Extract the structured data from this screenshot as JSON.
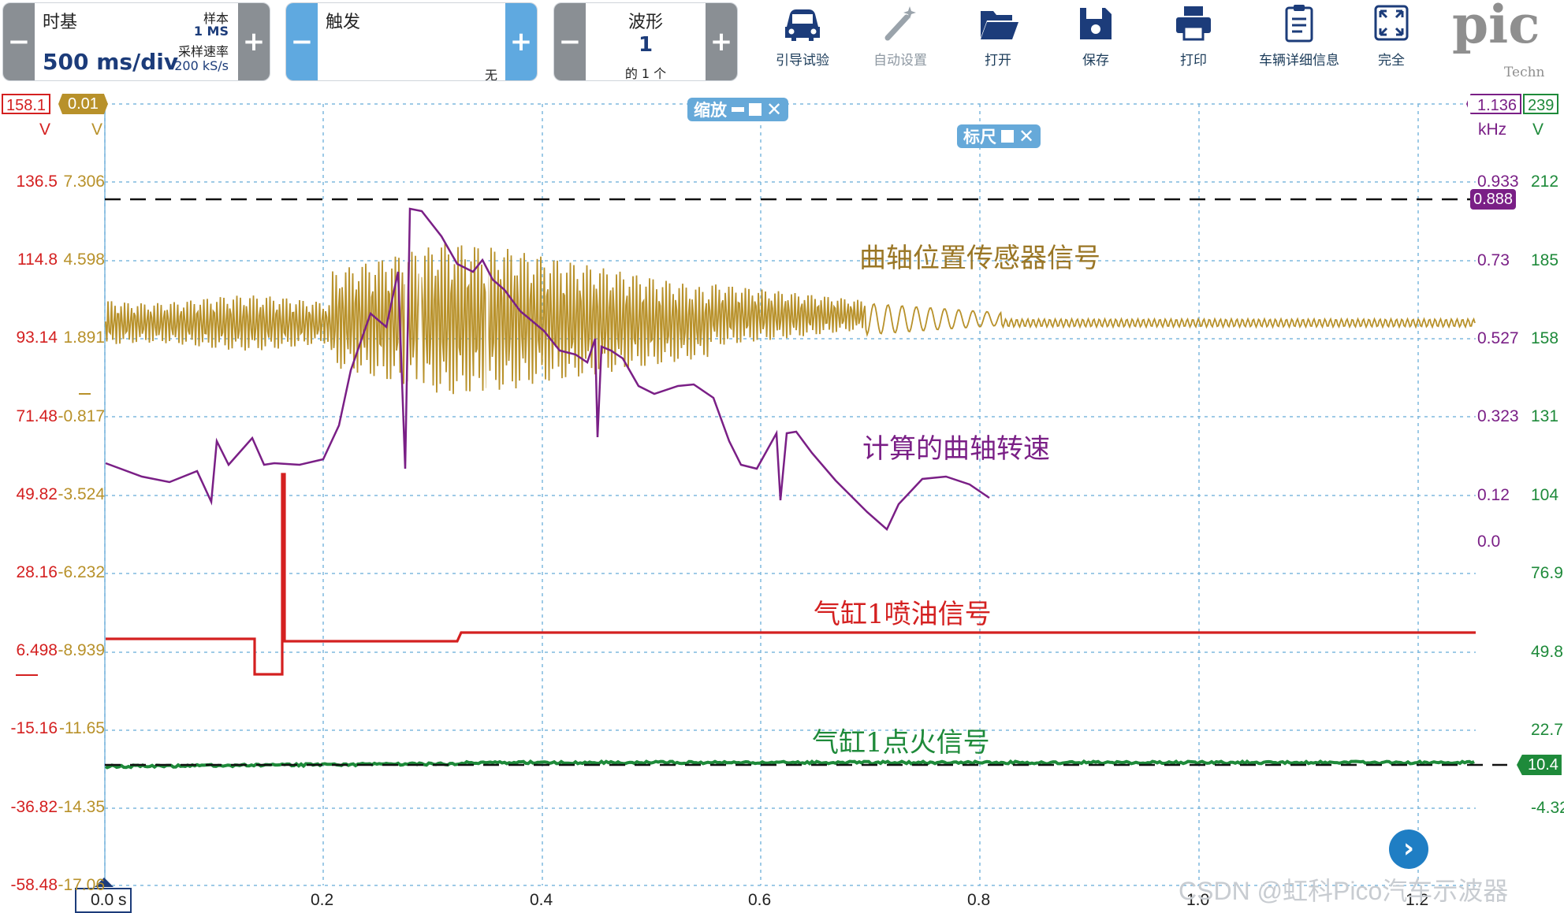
{
  "toolbar": {
    "timebase": {
      "title": "时基",
      "value": "500 ms/div",
      "samples_label": "样本",
      "samples_value": "1 MS",
      "rate_label": "采样速率",
      "rate_value": "200 kS/s"
    },
    "trigger": {
      "title": "触发",
      "mode": "无"
    },
    "waveform": {
      "title": "波形",
      "value": "1",
      "of": "的 1 个"
    },
    "tools": [
      {
        "label": "引导试验",
        "icon": "car-icon"
      },
      {
        "label": "自动设置",
        "icon": "magic-wand-icon"
      },
      {
        "label": "打开",
        "icon": "folder-open-icon"
      },
      {
        "label": "保存",
        "icon": "save-icon"
      },
      {
        "label": "打印",
        "icon": "printer-icon"
      },
      {
        "label": "车辆详细信息",
        "icon": "clipboard-icon"
      },
      {
        "label": "完全",
        "icon": "fullscreen-icon"
      }
    ],
    "logo": {
      "text": "pic",
      "sub": "Techn"
    }
  },
  "scope": {
    "zoom_chip": "缩放",
    "ruler_chip": "标尺",
    "channel_tags": {
      "a": "158.1",
      "b": "0.01",
      "math": "1.136",
      "d": "239",
      "d_ruler": "10.4",
      "math_ruler": "0.888"
    },
    "left_units": {
      "a": "V",
      "b": "V"
    },
    "right_units": {
      "math": "kHz",
      "d": "V"
    },
    "axis_a": [
      "136.5",
      "114.8",
      "93.14",
      "71.48",
      "49.82",
      "28.16",
      "6.498",
      "-15.16",
      "-36.82",
      "-58.48"
    ],
    "axis_b": [
      "7.306",
      "4.598",
      "1.891",
      "-0.817",
      "-3.524",
      "-6.232",
      "-8.939",
      "-11.65",
      "-14.35",
      "-17.06"
    ],
    "axis_math": [
      "0.933",
      "0.73",
      "0.527",
      "0.323",
      "0.12",
      "0.0"
    ],
    "axis_d": [
      "212",
      "185",
      "158",
      "131",
      "104",
      "76.9",
      "49.8",
      "22.7",
      "-4.32"
    ],
    "x_ticks": [
      "0.0 s",
      "0.2",
      "0.4",
      "0.6",
      "0.8",
      "1.0",
      "1.2"
    ],
    "labels": {
      "crank_sensor": "曲轴位置传感器信号",
      "crank_speed": "计算的曲轴转速",
      "injector": "气缸1喷油信号",
      "ignition": "气缸1点火信号"
    },
    "colors": {
      "crank": "#b8912a",
      "speed": "#7a1f86",
      "injector": "#d42020",
      "ignition": "#1e8a3a",
      "grid": "#7fb8dd"
    },
    "watermark": "CSDN @虹科Pico汽车示波器"
  }
}
